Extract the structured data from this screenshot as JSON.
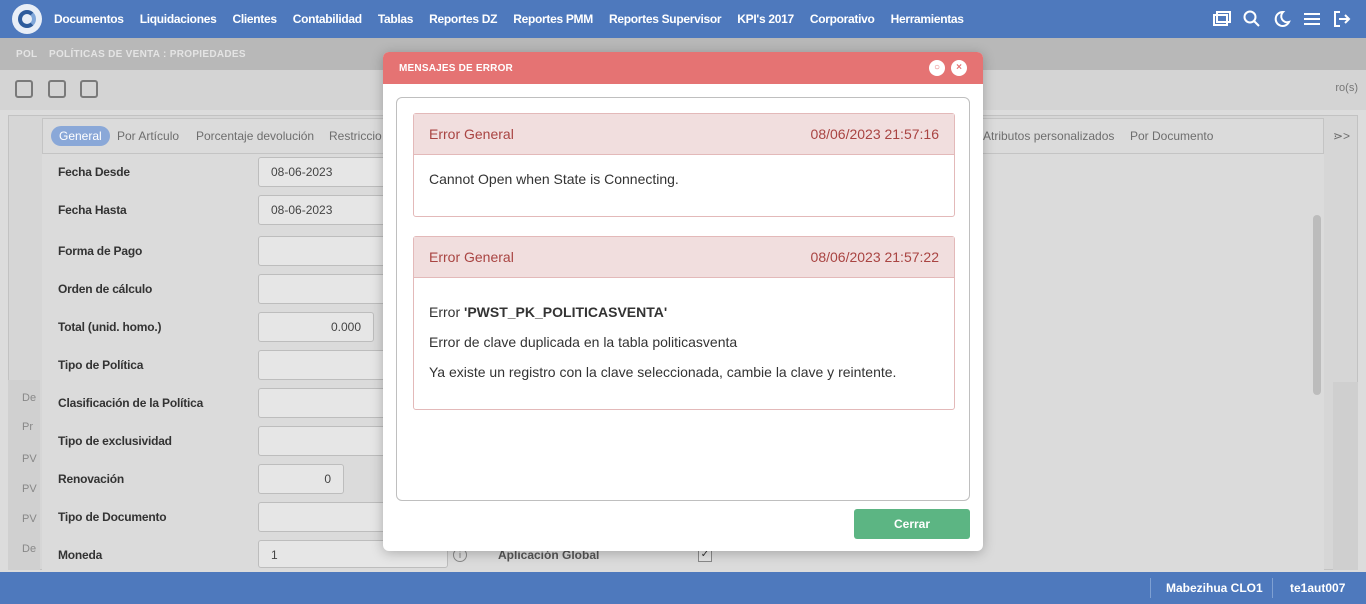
{
  "nav": {
    "items": [
      "Documentos",
      "Liquidaciones",
      "Clientes",
      "Contabilidad",
      "Tablas",
      "Reportes DZ",
      "Reportes PMM",
      "Reportes Supervisor",
      "KPI's 2017",
      "Corporativo",
      "Herramientas"
    ],
    "icons": [
      "windows-icon",
      "search-icon",
      "moon-icon",
      "menu-icon",
      "logout-icon"
    ]
  },
  "breadcrumb": {
    "prefix": "POL",
    "text": "POLÍTICAS DE VENTA : PROPIEDADES"
  },
  "toolbar": {
    "records": "ro(s)"
  },
  "tabs": [
    "General",
    "Por Artículo",
    "Porcentaje devolución",
    "Restriccio",
    "Atributos personalizados",
    "Por Documento"
  ],
  "tabs_more": "⋗>",
  "form": {
    "fields": [
      {
        "label": "Fecha Desde",
        "value": "08-06-2023"
      },
      {
        "label": "Fecha Hasta",
        "value": "08-06-2023"
      },
      {
        "label": "Forma de Pago",
        "value": ""
      },
      {
        "label": "Orden de cálculo",
        "value": ""
      },
      {
        "label": "Total (unid. homo.)",
        "value": "0.000"
      },
      {
        "label": "Tipo de Política",
        "value": ""
      },
      {
        "label": "Clasificación de la Política",
        "value": ""
      },
      {
        "label": "Tipo de exclusividad",
        "value": ""
      },
      {
        "label": "Renovación",
        "value": "0"
      },
      {
        "label": "Tipo de Documento",
        "value": ""
      },
      {
        "label": "Moneda",
        "value": "1"
      }
    ],
    "aplicacion_global": "Aplicación Global"
  },
  "left_strip": [
    "De",
    "Pr",
    "PV",
    "PV",
    "PV",
    "De"
  ],
  "status": {
    "user": "Mabezihua CLO1",
    "session": "te1aut007"
  },
  "modal": {
    "title": "MENSAJES DE ERROR",
    "errors": [
      {
        "title": "Error General",
        "time": "08/06/2023 21:57:16",
        "lines": [
          "Cannot Open when State is Connecting."
        ]
      },
      {
        "title": "Error General",
        "time": "08/06/2023 21:57:22",
        "line1_prefix": "Error ",
        "line1_bold": "'PWST_PK_POLITICASVENTA'",
        "line2": "Error de clave duplicada en la tabla politicasventa",
        "line3": "Ya existe un registro con la clave seleccionada, cambie la clave y reintente."
      }
    ],
    "close_label": "Cerrar"
  }
}
